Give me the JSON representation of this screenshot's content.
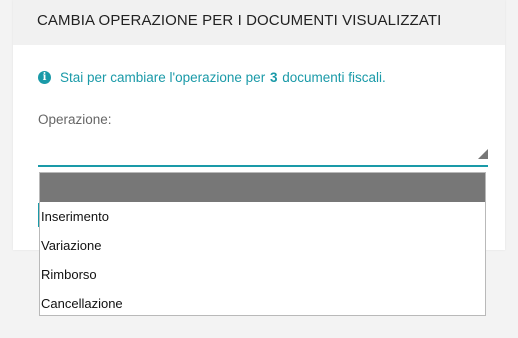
{
  "dialog": {
    "title": "CAMBIA OPERAZIONE PER I DOCUMENTI VISUALIZZATI",
    "info": {
      "icon": "info-icon",
      "prefix": "Stai per cambiare l'operazione per",
      "count": "3",
      "suffix": "documenti fiscali."
    },
    "operation_field": {
      "label": "Operazione:",
      "selected_value": "",
      "options": [
        "Inserimento",
        "Variazione",
        "Rimborso",
        "Cancellazione"
      ]
    }
  },
  "colors": {
    "accent": "#1a9aa8",
    "highlight": "#777777",
    "page_background": "#f3f3f3"
  }
}
